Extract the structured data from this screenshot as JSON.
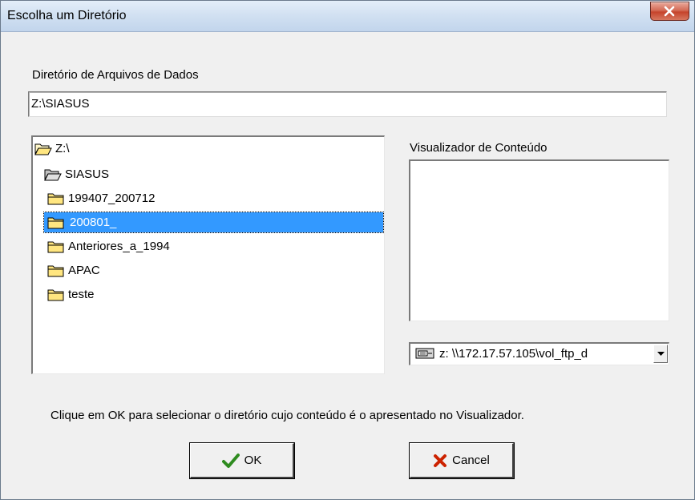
{
  "window": {
    "title": "Escolha um Diretório"
  },
  "path_section": {
    "label": "Diretório de Arquivos de Dados",
    "value": "Z:\\SIASUS"
  },
  "tree": {
    "items": [
      {
        "label": "Z:\\",
        "icon": "open-folder-icon",
        "depth": 0,
        "selected": false
      },
      {
        "label": "SIASUS",
        "icon": "open-folder-icon",
        "depth": 1,
        "selected": false
      },
      {
        "label": "199407_200712",
        "icon": "folder-icon",
        "depth": 2,
        "selected": false
      },
      {
        "label": "200801_",
        "icon": "folder-icon",
        "depth": 2,
        "selected": true
      },
      {
        "label": "Anteriores_a_1994",
        "icon": "folder-icon",
        "depth": 2,
        "selected": false
      },
      {
        "label": "APAC",
        "icon": "folder-icon",
        "depth": 2,
        "selected": false
      },
      {
        "label": "teste",
        "icon": "folder-icon",
        "depth": 2,
        "selected": false
      }
    ]
  },
  "viewer": {
    "label": "Visualizador de Conteúdo"
  },
  "drive": {
    "value": "z: \\\\172.17.57.105\\vol_ftp_d",
    "icon": "network-drive-icon"
  },
  "hint": "Clique em OK para selecionar o diretório cujo conteúdo é o apresentado no Visualizador.",
  "buttons": {
    "ok": "OK",
    "cancel": "Cancel"
  },
  "colors": {
    "selection": "#3399ff",
    "close": "#c5432b",
    "check": "#2e8b1f",
    "cancel_x": "#cc2200"
  }
}
